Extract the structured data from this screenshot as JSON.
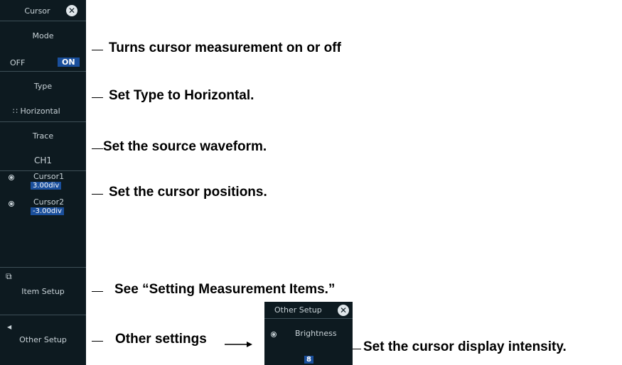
{
  "menu": {
    "title": "Cursor",
    "mode": {
      "label": "Mode",
      "off": "OFF",
      "on": "ON"
    },
    "type": {
      "label": "Type",
      "icon": "horizontal-cursor-icon",
      "value": "Horizontal"
    },
    "trace": {
      "label": "Trace",
      "value": "CH1"
    },
    "cursor1": {
      "label": "Cursor1",
      "value": "3.00div"
    },
    "cursor2": {
      "label": "Cursor2",
      "value": "-3.00div"
    },
    "item_setup": {
      "label": "Item Setup"
    },
    "other_setup": {
      "label": "Other Setup"
    }
  },
  "submenu": {
    "title": "Other Setup",
    "brightness": {
      "label": "Brightness",
      "value": "8"
    }
  },
  "callouts": {
    "mode": "Turns cursor measurement on or off",
    "type": "Set Type to Horizontal.",
    "trace": "Set the source waveform.",
    "cursor": "Set the cursor positions.",
    "item_setup": "See “Setting Measurement Items.”",
    "other_setup": "Other settings",
    "brightness": "Set the cursor display intensity."
  },
  "colors": {
    "panel": "#0d1a20",
    "highlight": "#1a4f9c",
    "text": "#c9d3d8"
  }
}
